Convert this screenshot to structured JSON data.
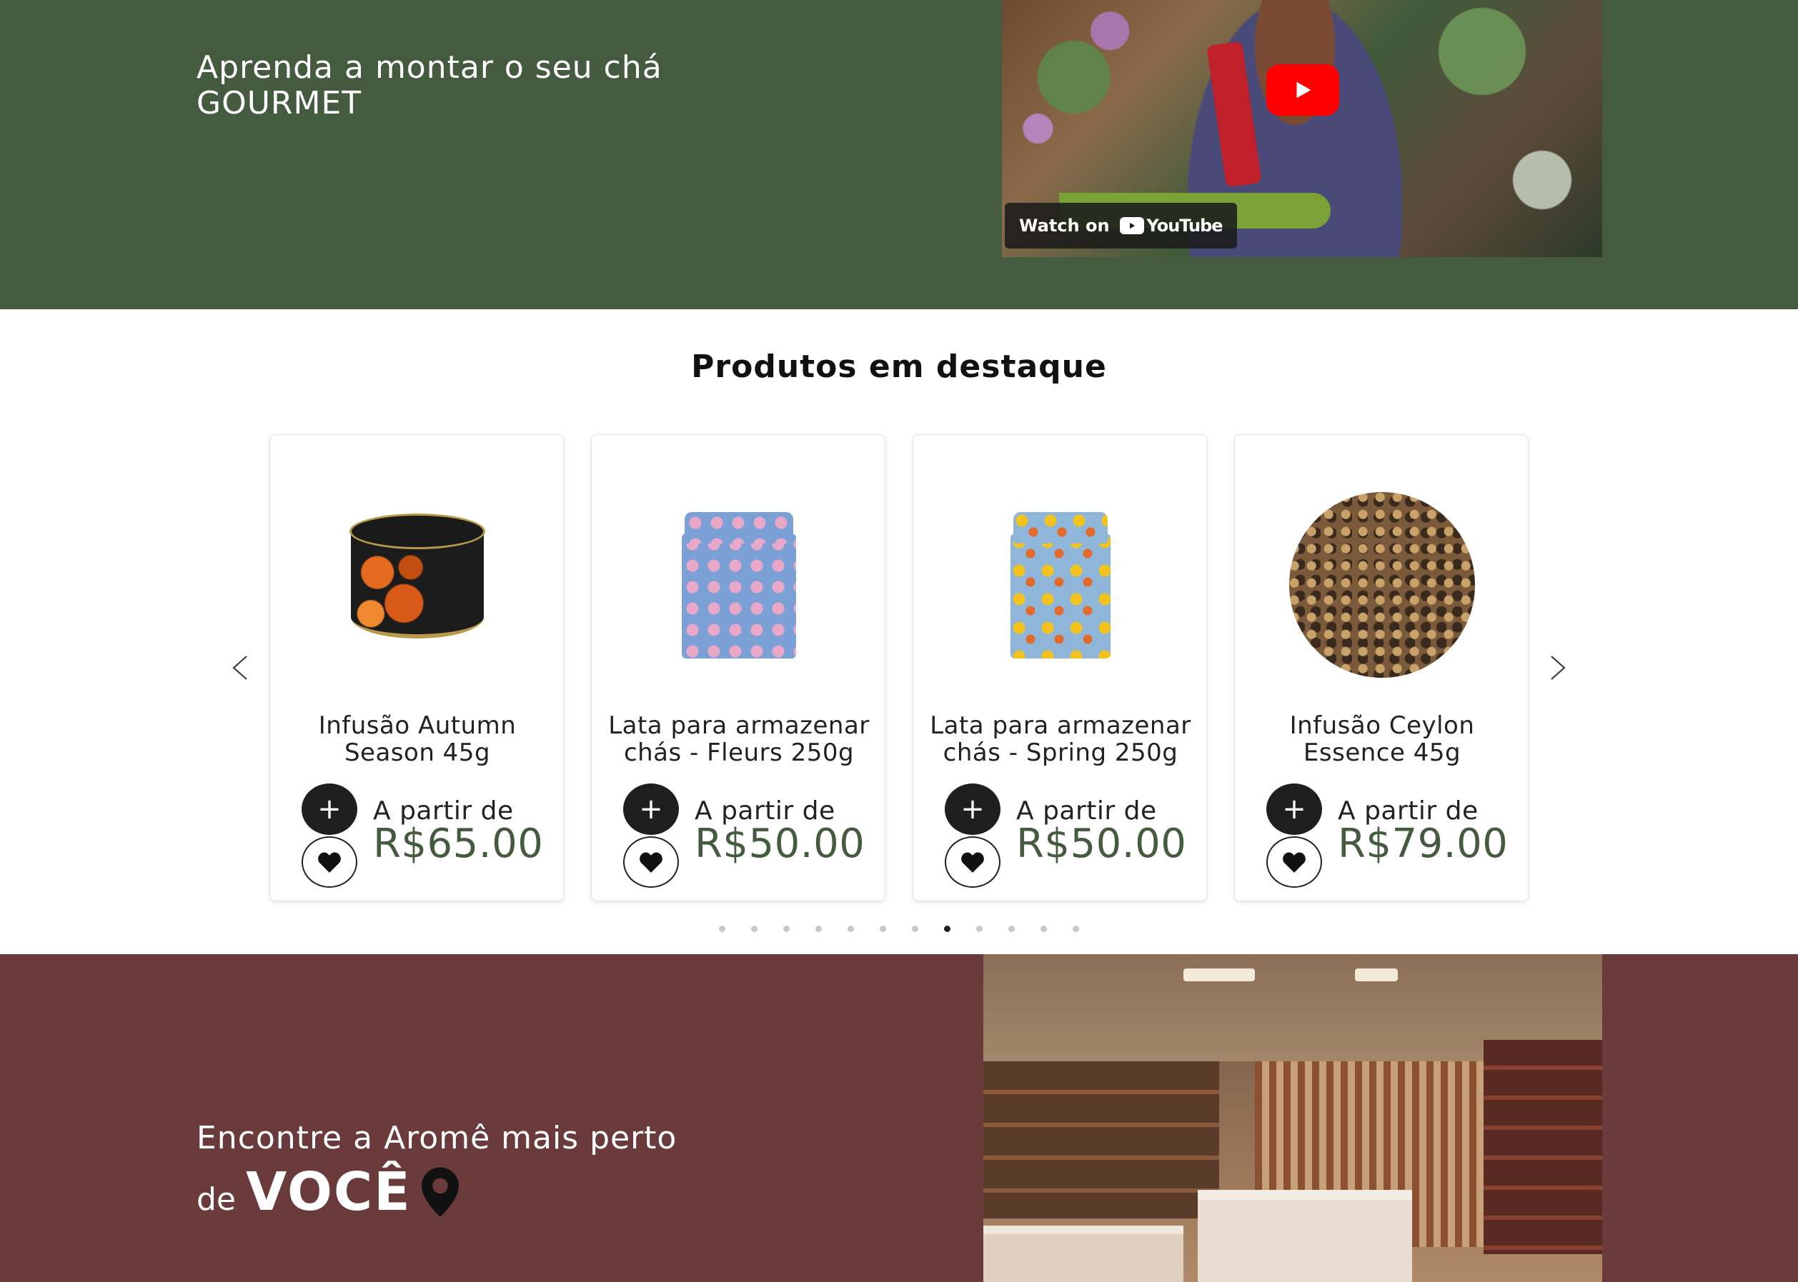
{
  "hero": {
    "title_line1": "Aprenda a montar o seu chá",
    "title_line2": "GOURMET",
    "video": {
      "watch_on": "Watch on",
      "youtube_label": "YouTube",
      "play_icon": "play-icon"
    }
  },
  "featured": {
    "title": "Produtos em destaque",
    "prev_icon": "chevron-left-icon",
    "next_icon": "chevron-right-icon",
    "products": [
      {
        "name": "Infusão Autumn Season 45g",
        "price_prefix": "A partir de",
        "price": "R$65.00"
      },
      {
        "name": "Lata para armazenar chás - Fleurs 250g",
        "price_prefix": "A partir de",
        "price": "R$50.00"
      },
      {
        "name": "Lata para armazenar chás - Spring 250g",
        "price_prefix": "A partir de",
        "price": "R$50.00"
      },
      {
        "name": "Infusão Ceylon Essence 45g",
        "price_prefix": "A partir de",
        "price": "R$79.00"
      }
    ],
    "add_symbol": "+",
    "pagination": {
      "total": 12,
      "active": 8
    }
  },
  "store": {
    "title_line1": "Encontre a Aromê mais perto",
    "title_de": "de",
    "title_voce": "VOCÊ",
    "pin_icon": "map-pin-icon"
  },
  "colors": {
    "green_band": "#455b40",
    "maroon_band": "#6b3a3a",
    "price_green": "#455b40",
    "youtube_red": "#ff0000"
  }
}
